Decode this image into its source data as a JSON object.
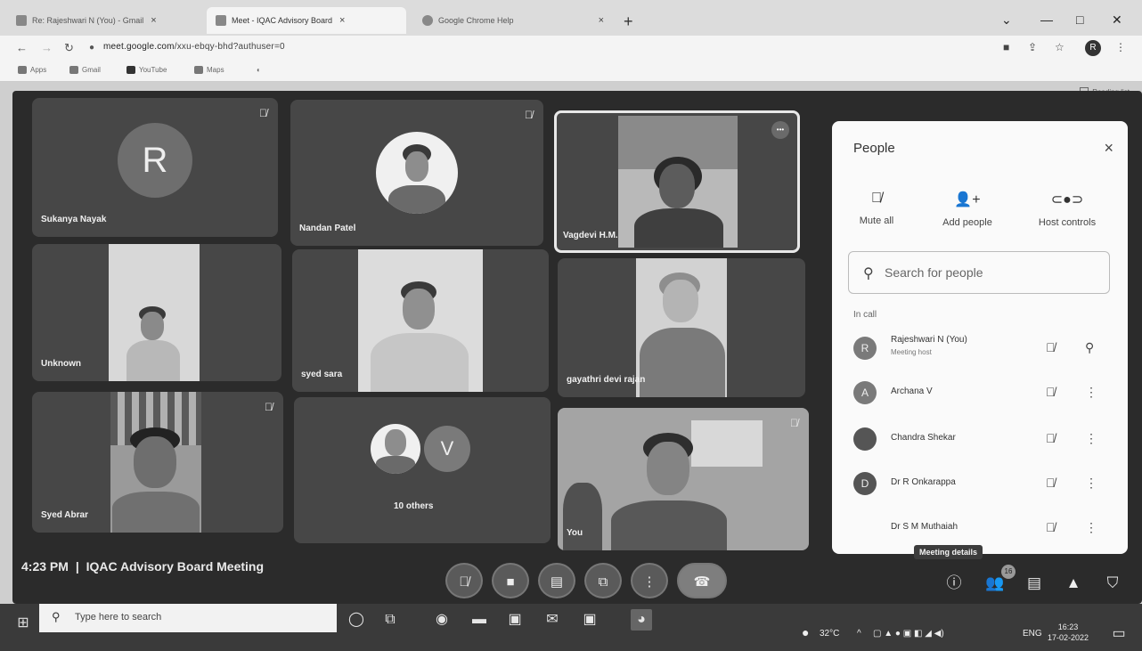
{
  "browser": {
    "tabs": [
      {
        "title": "Re: Rajeshwari N (You) - Gmail",
        "close": "×"
      },
      {
        "title": "Meet - IQAC Advisory Board",
        "close": "×"
      },
      {
        "title": "Google Chrome Help",
        "close": "×"
      }
    ],
    "new_tab": "+",
    "url_host": "meet.google.com",
    "url_path": "/xxu-ebqy-bhd?authuser=0",
    "profile_initial": "R",
    "bookmarks": [
      "Apps",
      "Gmail",
      "YouTube",
      "Maps"
    ],
    "reading_list": "Reading list"
  },
  "tiles": [
    {
      "name": "Sukanya Nayak",
      "avatar": "R"
    },
    {
      "name": "Nandan Patel"
    },
    {
      "name": "Vagdevi H.M."
    },
    {
      "name": "Unknown"
    },
    {
      "name": "syed sara"
    },
    {
      "name": "gayathri devi rajan"
    },
    {
      "name": "Syed Abrar"
    },
    {
      "name": "10 others",
      "avatar": "V"
    },
    {
      "name": "You"
    }
  ],
  "meeting": {
    "time": "4:23 PM",
    "separator": "|",
    "title": "IQAC Advisory Board Meeting",
    "tooltip": "Meeting details",
    "participants_badge": "16"
  },
  "people_panel": {
    "title": "People",
    "close": "×",
    "host_controls": {
      "mute_all": "Mute all",
      "add_people": "Add people",
      "host_controls": "Host controls"
    },
    "search_placeholder": "Search for people",
    "in_call_label": "In call",
    "participants": [
      {
        "name": "Rajeshwari N (You)",
        "subtitle": "Meeting host",
        "avatar": "R"
      },
      {
        "name": "Archana V",
        "avatar": "A"
      },
      {
        "name": "Chandra Shekar",
        "avatar": ""
      },
      {
        "name": "Dr R Onkarappa",
        "avatar": "D"
      },
      {
        "name": "Dr S M Muthaiah",
        "avatar": ""
      }
    ]
  },
  "taskbar": {
    "search_text": "Type here to search",
    "weather": "32°C",
    "language": "ENG",
    "time": "16:23",
    "date": "17-02-2022"
  }
}
